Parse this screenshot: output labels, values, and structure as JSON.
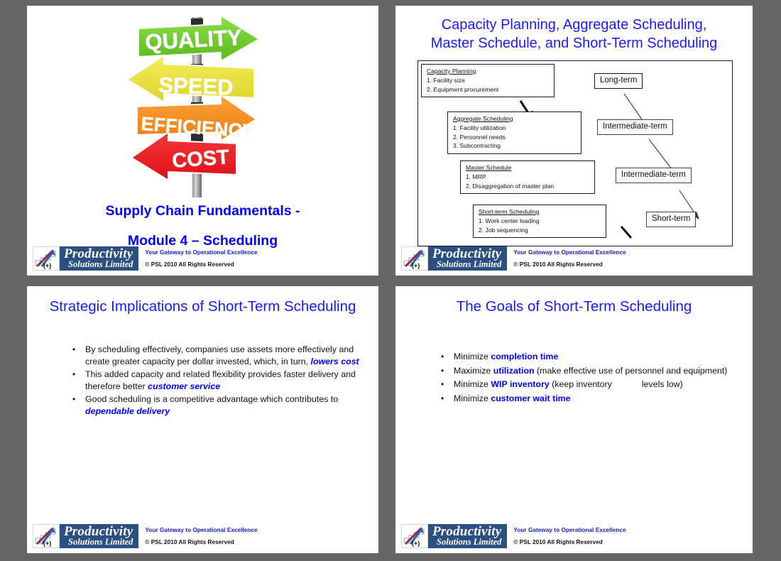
{
  "page": {
    "background_color": "#666666",
    "slide_background": "#ffffff",
    "accent_blue": "#0000ff",
    "title_blue": "#1a1aff",
    "brand_navy": "#2b4f81"
  },
  "footer": {
    "brand_line1": "Productivity",
    "brand_line2": "Solutions Limited",
    "tagline": "Your Gateway to Operational Excellence",
    "copyright": "© PSL 2010 All Rights Reserved",
    "logo_icon": "growth-arrow-chart-icon"
  },
  "slide1": {
    "signpost": {
      "alt": "four-direction signpost graphic",
      "signs": [
        {
          "label": "QUALITY",
          "color": "#6ec82a",
          "direction": "right"
        },
        {
          "label": "SPEED",
          "color": "#e8e032",
          "direction": "left"
        },
        {
          "label": "EFFICIENCY",
          "color": "#f28c1e",
          "direction": "right"
        },
        {
          "label": "COST",
          "color": "#ed1c24",
          "direction": "left"
        }
      ]
    },
    "title_line1": "Supply Chain Fundamentals -",
    "title_line2": "Module 4 – Scheduling"
  },
  "slide2": {
    "title_line1": "Capacity Planning, Aggregate Scheduling,",
    "title_line2": "Master Schedule, and Short-Term Scheduling",
    "flow_boxes": [
      {
        "heading": "Capacity Planning",
        "items": [
          "1.  Facility size",
          "2.  Equipment procurement"
        ]
      },
      {
        "heading": "Aggregate Scheduling",
        "items": [
          "1.  Facility utilization",
          "2.  Personnel needs",
          "3.  Subcontracting"
        ]
      },
      {
        "heading": "Master Schedule",
        "items": [
          "1.   MRP",
          "2.   Disaggregation of  master plan"
        ]
      },
      {
        "heading": "Short-term Scheduling",
        "items": [
          "1. Work center loading",
          "2. Job sequencing"
        ]
      }
    ],
    "horizon_boxes": [
      {
        "label": "Long-term"
      },
      {
        "label": "Intermediate-term"
      },
      {
        "label": "Intermediate-term"
      },
      {
        "label": "Short-term"
      }
    ]
  },
  "slide3": {
    "title": "Strategic Implications of Short-Term Scheduling",
    "bullets": [
      {
        "parts": [
          {
            "t": "By scheduling effectively, companies use assets more effectively and create greater capacity per dollar invested, which, in turn, ",
            "style": "plain"
          },
          {
            "t": "lowers cost",
            "style": "bold-italic"
          }
        ]
      },
      {
        "parts": [
          {
            "t": "This added capacity and related flexibility provides faster delivery and therefore better ",
            "style": "plain"
          },
          {
            "t": "customer service",
            "style": "bold-italic"
          }
        ]
      },
      {
        "parts": [
          {
            "t": "Good scheduling is a competitive advantage which contributes to ",
            "style": "plain"
          },
          {
            "t": "dependable delivery",
            "style": "bold-italic"
          }
        ]
      }
    ]
  },
  "slide4": {
    "title": "The Goals of Short-Term Scheduling",
    "bullets": [
      {
        "parts": [
          {
            "t": "Minimize ",
            "style": "plain"
          },
          {
            "t": "completion time",
            "style": "bold"
          }
        ]
      },
      {
        "parts": [
          {
            "t": "Maximize ",
            "style": "plain"
          },
          {
            "t": "utilization",
            "style": "bold"
          },
          {
            "t": " (make effective use of personnel and equipment)",
            "style": "plain"
          }
        ]
      },
      {
        "parts": [
          {
            "t": "Minimize ",
            "style": "plain"
          },
          {
            "t": "WIP inventory",
            "style": "bold"
          },
          {
            "t": " (keep inventory",
            "style": "plain"
          },
          {
            "t": "GAP",
            "style": "gap"
          },
          {
            "t": "levels low)",
            "style": "plain"
          }
        ]
      },
      {
        "parts": [
          {
            "t": "Minimize ",
            "style": "plain"
          },
          {
            "t": "customer wait time",
            "style": "bold"
          }
        ]
      }
    ]
  },
  "bullet_glyph": "•"
}
